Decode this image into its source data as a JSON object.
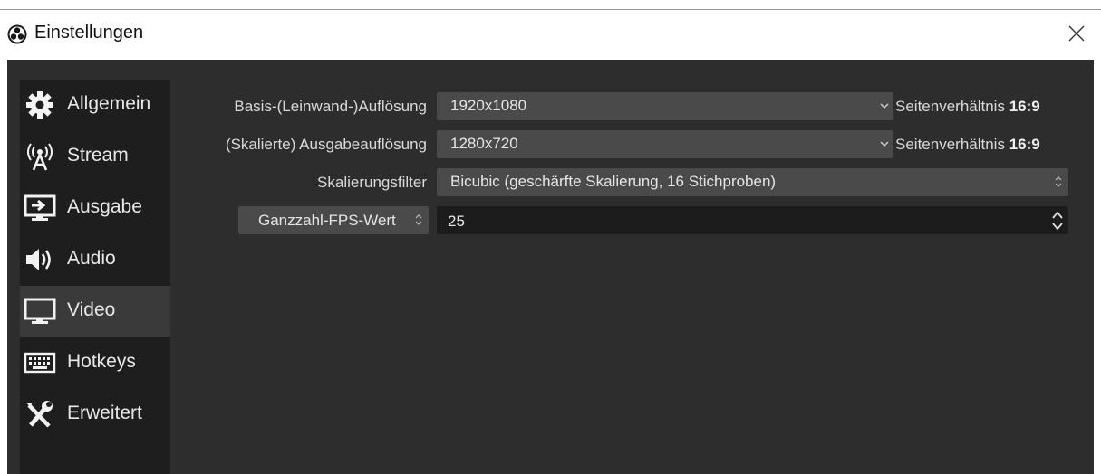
{
  "window": {
    "title": "Einstellungen"
  },
  "sidebar": {
    "items": [
      {
        "label": "Allgemein",
        "icon": "gear-icon"
      },
      {
        "label": "Stream",
        "icon": "broadcast-antenna-icon"
      },
      {
        "label": "Ausgabe",
        "icon": "monitor-output-icon"
      },
      {
        "label": "Audio",
        "icon": "speaker-icon"
      },
      {
        "label": "Video",
        "icon": "monitor-icon",
        "active": true
      },
      {
        "label": "Hotkeys",
        "icon": "keyboard-icon"
      },
      {
        "label": "Erweitert",
        "icon": "tools-icon"
      }
    ]
  },
  "video": {
    "base_resolution": {
      "label": "Basis-(Leinwand-)Auflösung",
      "value": "1920x1080",
      "aspect_prefix": "Seitenverhältnis",
      "aspect_value": "16:9"
    },
    "output_resolution": {
      "label": "(Skalierte) Ausgabeauflösung",
      "value": "1280x720",
      "aspect_prefix": "Seitenverhältnis",
      "aspect_value": "16:9"
    },
    "scale_filter": {
      "label": "Skalierungsfilter",
      "value": "Bicubic (geschärfte Skalierung, 16 Stichproben)"
    },
    "fps": {
      "mode": "Ganzzahl-FPS-Wert",
      "value": "25"
    }
  },
  "colors": {
    "panel_bg": "#2d2d2d",
    "sidebar_bg": "#1e1e1e",
    "active_item": "#3a3a3a",
    "control_bg": "#4a4a4a",
    "input_bg": "#1c1c1c"
  }
}
